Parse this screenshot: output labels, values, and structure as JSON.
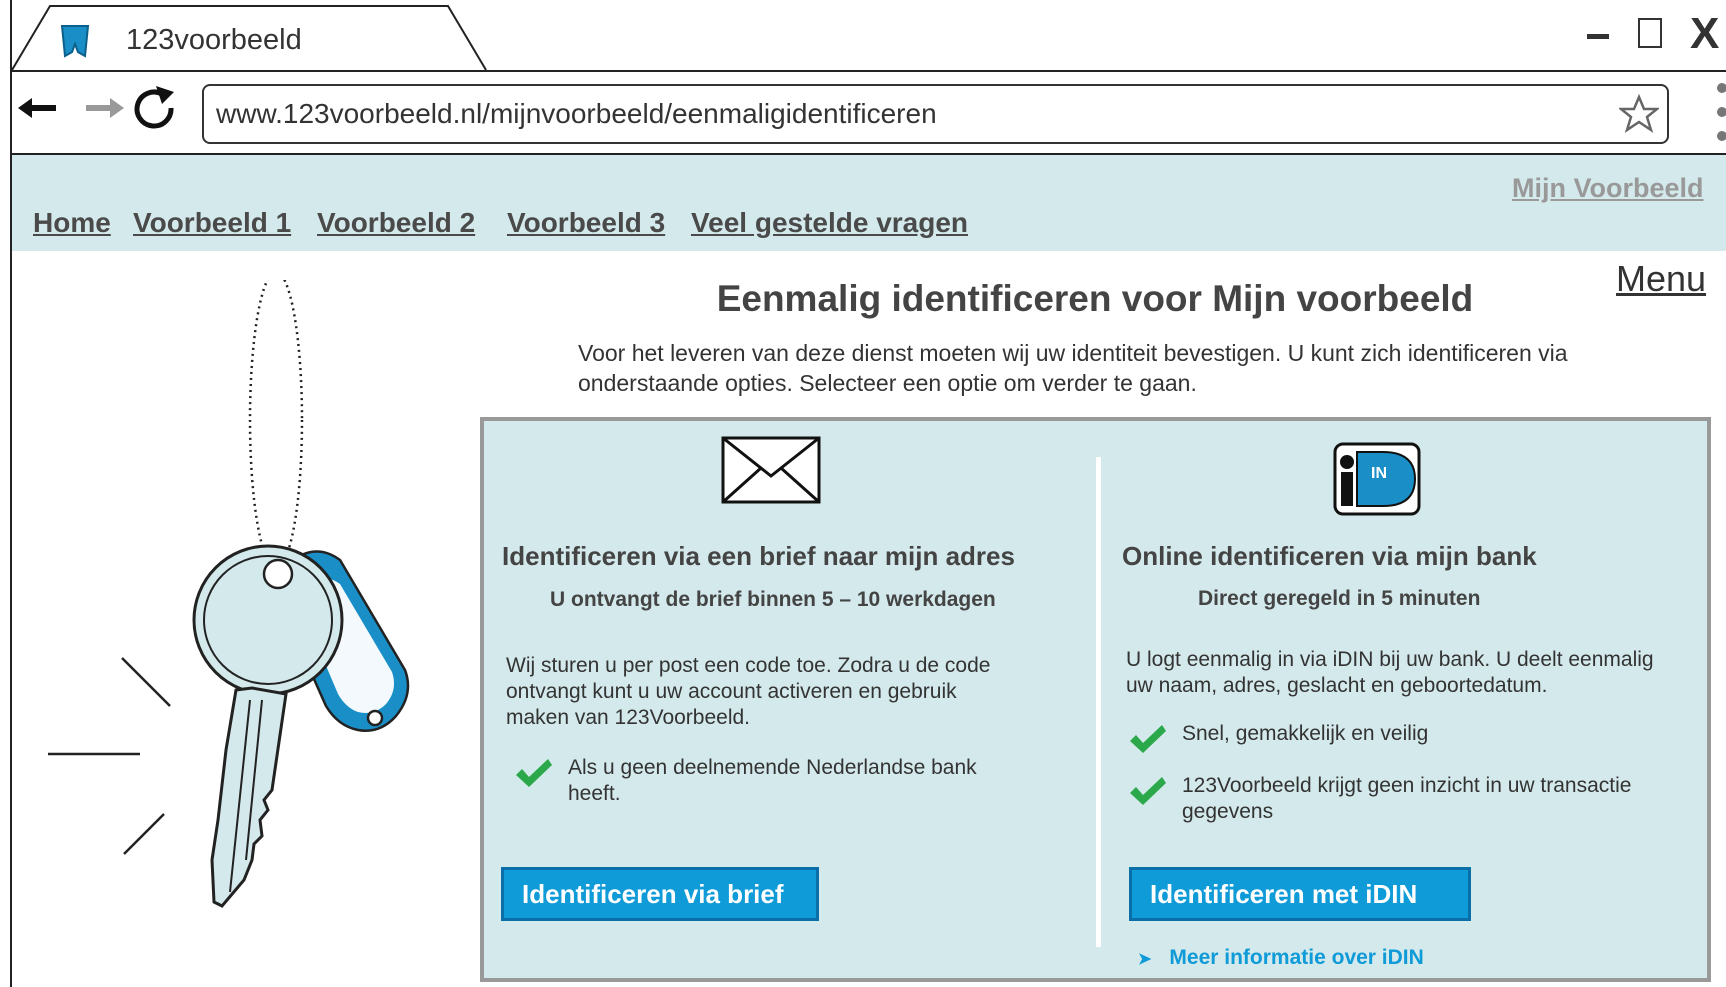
{
  "browser": {
    "tab_title": "123voorbeeld",
    "url": "www.123voorbeeld.nl/mijnvoorbeeld/eenmaligidentificeren",
    "icons": [
      "back-arrow-icon",
      "forward-arrow-icon",
      "reload-icon",
      "star-icon",
      "kebab-menu-icon",
      "minimize-icon",
      "maximize-icon",
      "close-icon"
    ],
    "close_glyph": "X"
  },
  "header": {
    "nav": [
      "Home",
      "Voorbeeld 1",
      "Voorbeeld 2",
      "Voorbeeld 3",
      "Veel gestelde vragen"
    ],
    "account_link": "Mijn Voorbeeld",
    "background": "#d4e9eb"
  },
  "menu_link": "Menu",
  "main": {
    "title": "Eenmalig identificeren voor Mijn voorbeeld",
    "intro_line1": "Voor het leveren van deze dienst moeten wij uw identiteit bevestigen. U kunt zich identificeren via",
    "intro_line2": "onderstaande opties. Selecteer een optie om verder te gaan."
  },
  "options": {
    "letter": {
      "icon": "envelope-icon",
      "title": "Identificeren via een brief naar mijn adres",
      "subtitle": "U ontvangt de brief binnen 5 – 10 werkdagen",
      "desc_l1": "Wij sturen u per post een code toe. Zodra u de code",
      "desc_l2": "ontvangt kunt u uw account activeren en gebruik",
      "desc_l3": "maken van 123Voorbeeld.",
      "check1_l1": "Als u geen deelnemende Nederlandse bank",
      "check1_l2": "heeft.",
      "button": "Identificeren via brief"
    },
    "idin": {
      "icon": "idin-logo-icon",
      "logo_text": "IN",
      "title": "Online identificeren via mijn bank",
      "subtitle": "Direct geregeld in 5 minuten",
      "desc_l1": "U logt eenmalig in via iDIN bij uw bank. U deelt eenmalig",
      "desc_l2": "uw naam, adres, geslacht en geboortedatum.",
      "check1": "Snel, gemakkelijk en veilig",
      "check2_l1": "123Voorbeeld krijgt geen inzicht in uw transactie",
      "check2_l2": "gegevens",
      "button": "Identificeren met iDIN",
      "more_info": "Meer informatie over iDIN"
    }
  },
  "colors": {
    "accent_blue": "#0f9ad8",
    "check_green": "#2aa84a",
    "panel_bg": "#d4e9eb"
  }
}
